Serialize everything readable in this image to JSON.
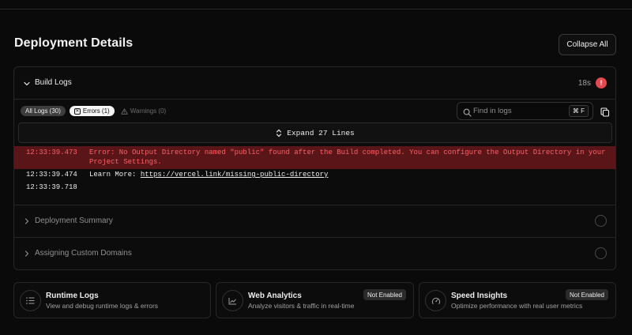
{
  "page": {
    "title": "Deployment Details",
    "collapse_all": "Collapse All"
  },
  "build_logs": {
    "title": "Build Logs",
    "duration": "18s",
    "error_mark": "!",
    "filters": {
      "all": "All Logs (30)",
      "errors": "Errors (1)",
      "warnings": "Warnings (0)"
    },
    "search": {
      "placeholder": "Find in logs",
      "shortcut": "⌘ F"
    },
    "expand_label": "Expand 27 Lines",
    "lines": [
      {
        "time": "12:33:39.473",
        "message": "Error: No Output Directory named \"public\" found after the Build completed. You can configure the Output Directory in your Project Settings.",
        "level": "error"
      },
      {
        "time": "12:33:39.474",
        "message_prefix": "Learn More: ",
        "link": "https://vercel.link/missing-public-directory",
        "level": "info"
      },
      {
        "time": "12:33:39.718",
        "message": "",
        "level": "info"
      }
    ]
  },
  "sections": [
    {
      "title": "Deployment Summary"
    },
    {
      "title": "Assigning Custom Domains"
    }
  ],
  "features": [
    {
      "title": "Runtime Logs",
      "description": "View and debug runtime logs & errors",
      "icon": "list-icon",
      "badge": ""
    },
    {
      "title": "Web Analytics",
      "description": "Analyze visitors & traffic in real-time",
      "icon": "chart-icon",
      "badge": "Not Enabled"
    },
    {
      "title": "Speed Insights",
      "description": "Optimize performance with real user metrics",
      "icon": "gauge-icon",
      "badge": "Not Enabled"
    }
  ],
  "colors": {
    "background": "#0a0a0a",
    "error_row": "#5a1518",
    "error_text": "#ff6166",
    "error_badge": "#e5484d"
  }
}
